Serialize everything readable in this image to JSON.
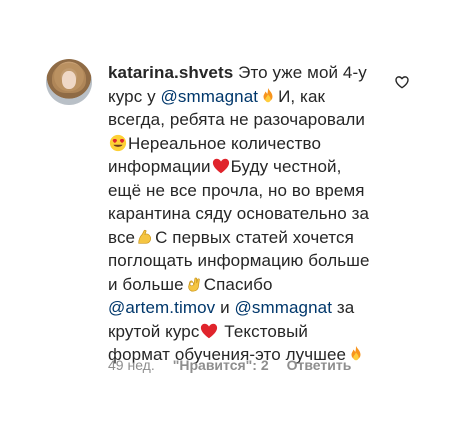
{
  "comment": {
    "username": "katarina.shvets",
    "lines": [
      [
        {
          "t": "text",
          "v": " Это уже мой 4-у"
        }
      ],
      [
        {
          "t": "text",
          "v": "курс у "
        },
        {
          "t": "mention",
          "v": "@smmagnat"
        },
        {
          "t": "emoji",
          "v": "fire"
        },
        {
          "t": "text",
          "v": "И, как"
        }
      ],
      [
        {
          "t": "text",
          "v": "всегда, ребята не разочаровали"
        }
      ],
      [
        {
          "t": "emoji",
          "v": "heart-eyes"
        },
        {
          "t": "text",
          "v": "Нереальное количество"
        }
      ],
      [
        {
          "t": "text",
          "v": "информации"
        },
        {
          "t": "emoji",
          "v": "heart"
        },
        {
          "t": "text",
          "v": "Буду честной,"
        }
      ],
      [
        {
          "t": "text",
          "v": "ещё не все прочла, но во время"
        }
      ],
      [
        {
          "t": "text",
          "v": "карантина сяду основательно за"
        }
      ],
      [
        {
          "t": "text",
          "v": "все"
        },
        {
          "t": "emoji",
          "v": "flexed-biceps"
        },
        {
          "t": "text",
          "v": "С первых статей хочется"
        }
      ],
      [
        {
          "t": "text",
          "v": "поглощать информацию больше"
        }
      ],
      [
        {
          "t": "text",
          "v": "и больше"
        },
        {
          "t": "emoji",
          "v": "ok-hand"
        },
        {
          "t": "text",
          "v": "Спасибо"
        }
      ],
      [
        {
          "t": "mention",
          "v": "@artem.timov"
        },
        {
          "t": "text",
          "v": " и "
        },
        {
          "t": "mention",
          "v": "@smmagnat"
        },
        {
          "t": "text",
          "v": " за"
        }
      ],
      [
        {
          "t": "text",
          "v": "крутой курс"
        },
        {
          "t": "emoji",
          "v": "heart"
        },
        {
          "t": "text",
          "v": " Текстовый"
        }
      ],
      [
        {
          "t": "text",
          "v": "формат обучения-это лучшее"
        },
        {
          "t": "emoji",
          "v": "fire"
        }
      ]
    ],
    "time": "49 нед.",
    "likes": "\"Нравится\": 2",
    "reply": "Ответить",
    "icons": {
      "like": "heart-outline-icon",
      "avatar": "user-avatar"
    }
  }
}
